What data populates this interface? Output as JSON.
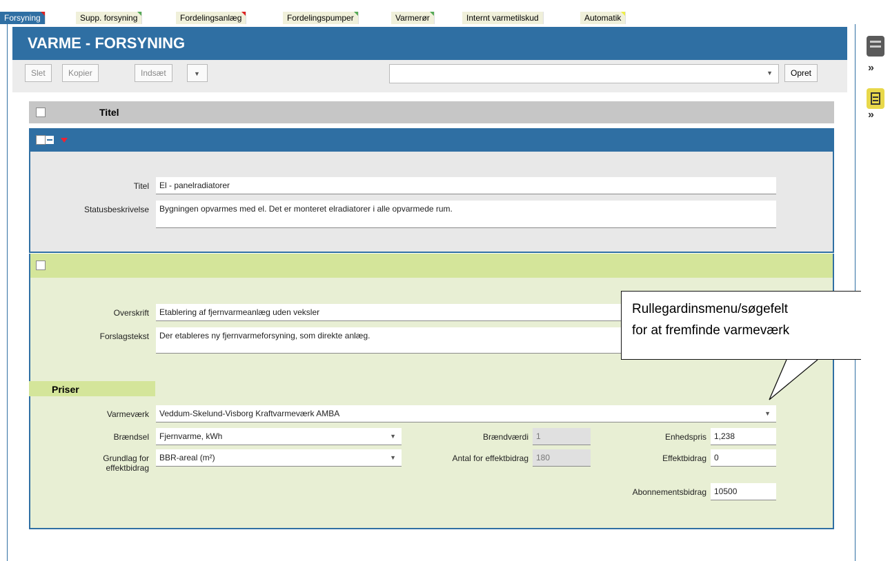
{
  "tabs": [
    {
      "label": "Forsyning",
      "active": true,
      "corner": "red"
    },
    {
      "label": "Supp. forsyning",
      "active": false,
      "corner": "green"
    },
    {
      "label": "Fordelingsanlæg",
      "active": false,
      "corner": "red"
    },
    {
      "label": "Fordelingspumper",
      "active": false,
      "corner": "green"
    },
    {
      "label": "Varmerør",
      "active": false,
      "corner": "green"
    },
    {
      "label": "Internt varmetilskud",
      "active": false,
      "corner": "none"
    },
    {
      "label": "Automatik",
      "active": false,
      "corner": "yellow"
    }
  ],
  "header": {
    "title": "VARME - FORSYNING"
  },
  "toolbar": {
    "slet": "Slet",
    "kopier": "Kopier",
    "indsaet": "Indsæt",
    "opret": "Opret",
    "select_value": ""
  },
  "title_section": {
    "label": "Titel"
  },
  "status_section": {
    "titel_label": "Titel",
    "titel_value": "El - panelradiatorer",
    "status_label": "Statusbeskrivelse",
    "status_value": "Bygningen opvarmes med el. Det er monteret elradiatorer i alle opvarmede rum."
  },
  "proposal_section": {
    "overskrift_label": "Overskrift",
    "overskrift_value": "Etablering af fjernvarmeanlæg uden veksler",
    "forslag_label": "Forslagstekst",
    "forslag_value": "Der etableres ny fjernvarmeforsyning, som direkte anlæg."
  },
  "prices": {
    "heading": "Priser",
    "varmevaerk_label": "Varmeværk",
    "varmevaerk_value": "Veddum-Skelund-Visborg Kraftvarmeværk AMBA",
    "braendsel_label": "Brændsel",
    "braendsel_value": "Fjernvarme, kWh",
    "braendvaerdi_label": "Brændværdi",
    "braendvaerdi_value": "1",
    "enhedspris_label": "Enhedspris",
    "enhedspris_value": "1,238",
    "grundlag_label_1": "Grundlag for",
    "grundlag_label_2": "effektbidrag",
    "grundlag_value": "BBR-areal (m²)",
    "antal_label": "Antal for effektbidrag",
    "antal_value": "180",
    "effekt_label": "Effektbidrag",
    "effekt_value": "0",
    "abonnement_label": "Abonnementsbidrag",
    "abonnement_value": "10500"
  },
  "callout": {
    "line1": "Rullegardinsmenu/søgefelt",
    "line2": "for at fremfinde varmeværk"
  },
  "icons": {
    "dropdown": "triangle-down",
    "right_panel": "panel-icon",
    "expand": "chevron-double-right"
  },
  "colors": {
    "primary": "#2f6fa3",
    "section_green": "#d4e59a",
    "panel_icon": "#5a5a5a",
    "panel_icon_active": "#e8d84a"
  }
}
